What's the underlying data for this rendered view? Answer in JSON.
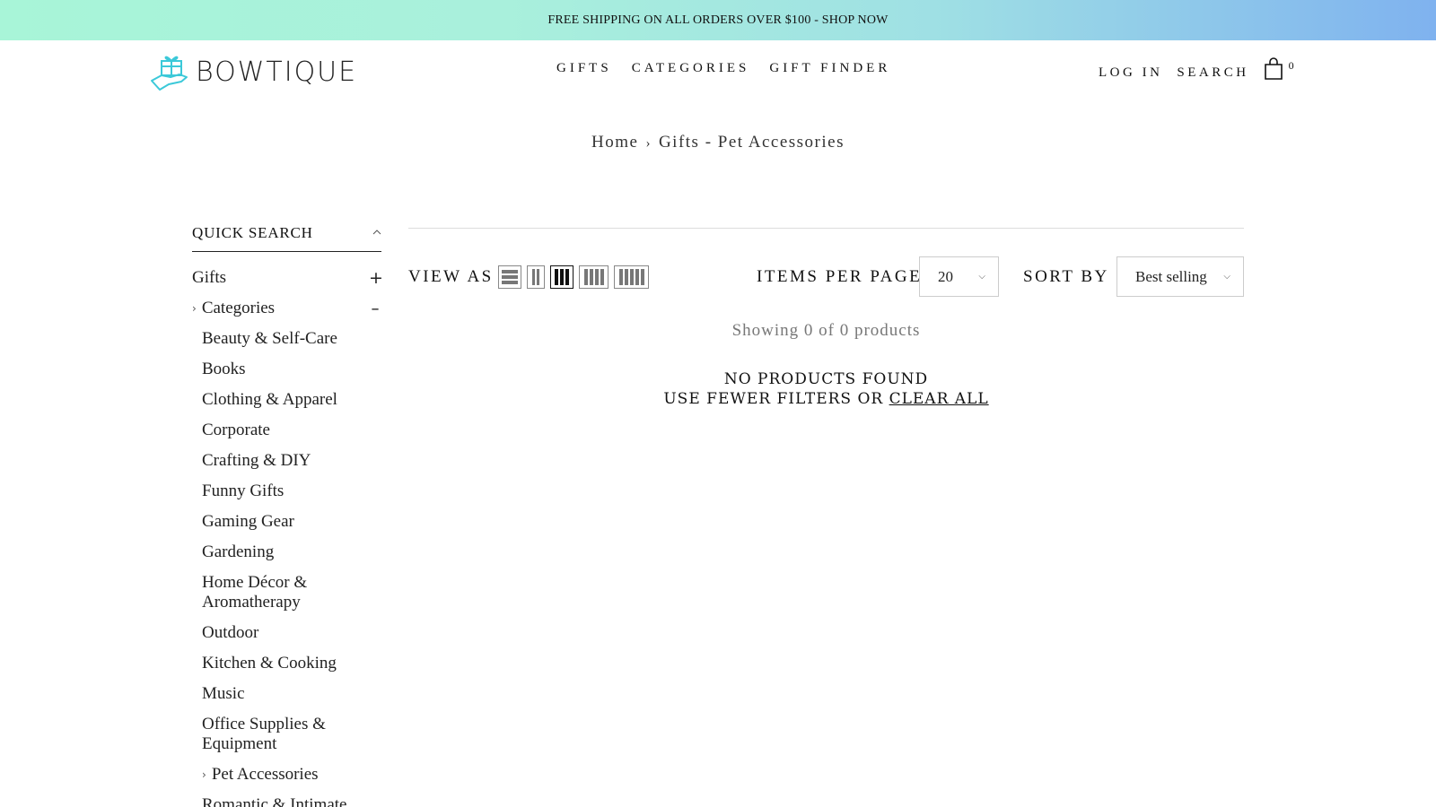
{
  "announcement": "FREE SHIPPING ON ALL ORDERS OVER $100 - SHOP NOW",
  "logo": {
    "text": "BOWTIQUE",
    "icon": "gift-hand-icon"
  },
  "nav": [
    {
      "label": "GIFTS"
    },
    {
      "label": "CATEGORIES"
    },
    {
      "label": "GIFT FINDER"
    }
  ],
  "utility": {
    "login": "LOG IN",
    "search": "SEARCH",
    "cart_count": "0",
    "cart_icon": "shopping-bag-icon"
  },
  "breadcrumb": {
    "home": "Home",
    "current": "Gifts - Pet Accessories"
  },
  "sidebar": {
    "title": "QUICK SEARCH",
    "gifts": "Gifts",
    "gifts_toggle": "+",
    "categories": "Categories",
    "categories_toggle": "–",
    "items": [
      "Beauty & Self-Care",
      "Books",
      "Clothing & Apparel",
      "Corporate",
      "Crafting & DIY",
      "Funny Gifts",
      "Gaming Gear",
      "Gardening",
      "Home Décor & Aromatherapy",
      "Outdoor",
      "Kitchen & Cooking",
      "Music",
      "Office Supplies & Equipment"
    ],
    "selected": "Pet Accessories",
    "partial": "Romantic & Intimate Gifts"
  },
  "toolbar": {
    "view_as": "VIEW AS",
    "items_per_page": "ITEMS PER PAGE",
    "ipp_value": "20",
    "sort_by": "SORT BY",
    "sort_value": "Best selling"
  },
  "results": {
    "showing": "Showing 0 of 0 products",
    "no_products": "NO PRODUCTS FOUND",
    "fewer_filters": "USE FEWER FILTERS OR",
    "clear_all": "CLEAR ALL"
  }
}
